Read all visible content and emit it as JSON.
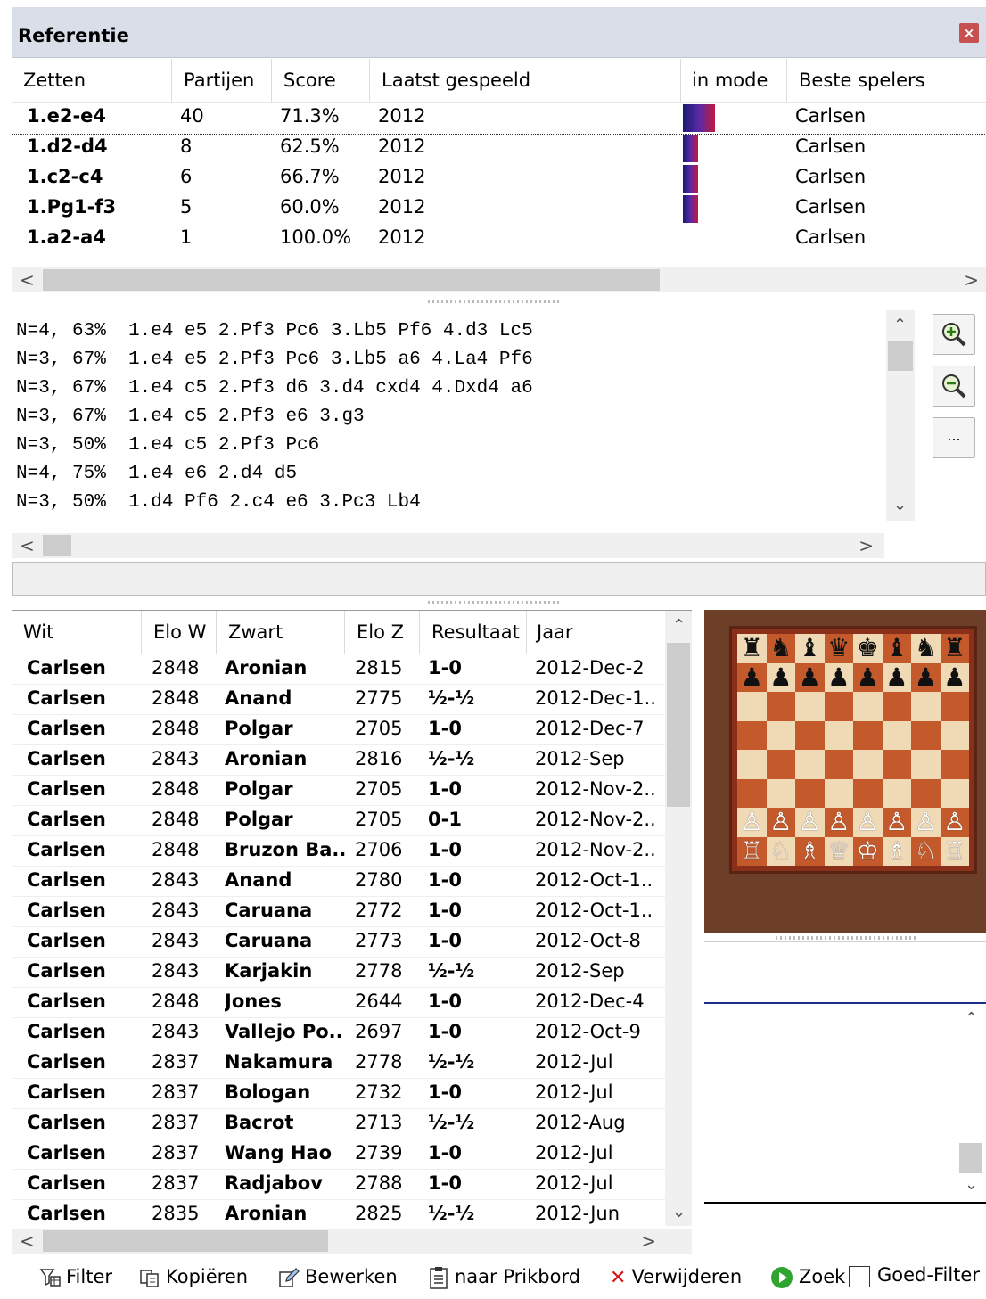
{
  "panel": {
    "title": "Referentie",
    "close": "×"
  },
  "moves_table": {
    "headers": [
      "Zetten",
      "Partijen",
      "Score",
      "Laatst gespeeld",
      "in mode",
      "Beste spelers"
    ],
    "rows": [
      {
        "move": "1.e2-e4",
        "games": "40",
        "score": "71.3%",
        "last": "2012",
        "trend": 1.0,
        "best": "Carlsen"
      },
      {
        "move": "1.d2-d4",
        "games": "8",
        "score": "62.5%",
        "last": "2012",
        "trend": 0.35,
        "best": "Carlsen"
      },
      {
        "move": "1.c2-c4",
        "games": "6",
        "score": "66.7%",
        "last": "2012",
        "trend": 0.35,
        "best": "Carlsen"
      },
      {
        "move": "1.Pg1-f3",
        "games": "5",
        "score": "60.0%",
        "last": "2012",
        "trend": 0.35,
        "best": "Carlsen"
      },
      {
        "move": "1.a2-a4",
        "games": "1",
        "score": "100.0%",
        "last": "2012",
        "trend": 0.0,
        "best": "Carlsen"
      }
    ]
  },
  "lines": [
    "N=4, 63%  1.e4 e5 2.Pf3 Pc6 3.Lb5 Pf6 4.d3 Lc5",
    "N=3, 67%  1.e4 e5 2.Pf3 Pc6 3.Lb5 a6 4.La4 Pf6",
    "N=3, 67%  1.e4 c5 2.Pf3 d6 3.d4 cxd4 4.Dxd4 a6",
    "N=3, 67%  1.e4 c5 2.Pf3 e6 3.g3",
    "N=3, 50%  1.e4 c5 2.Pf3 Pc6",
    "N=4, 75%  1.e4 e6 2.d4 d5",
    "N=3, 50%  1.d4 Pf6 2.c4 e6 3.Pc3 Lb4"
  ],
  "side_buttons": {
    "zoom_in": "zoom-in-icon",
    "zoom_out": "zoom-out-icon",
    "more": "..."
  },
  "games_table": {
    "headers": [
      "Wit",
      "Elo W",
      "Zwart",
      "Elo Z",
      "Resultaat",
      "Jaar"
    ],
    "rows": [
      [
        "Carlsen",
        "2848",
        "Aronian",
        "2815",
        "1-0",
        "2012-Dec-2"
      ],
      [
        "Carlsen",
        "2848",
        "Anand",
        "2775",
        "½-½",
        "2012-Dec-1.."
      ],
      [
        "Carlsen",
        "2848",
        "Polgar",
        "2705",
        "1-0",
        "2012-Dec-7"
      ],
      [
        "Carlsen",
        "2843",
        "Aronian",
        "2816",
        "½-½",
        "2012-Sep"
      ],
      [
        "Carlsen",
        "2848",
        "Polgar",
        "2705",
        "1-0",
        "2012-Nov-2.."
      ],
      [
        "Carlsen",
        "2848",
        "Polgar",
        "2705",
        "0-1",
        "2012-Nov-2.."
      ],
      [
        "Carlsen",
        "2848",
        "Bruzon Ba..",
        "2706",
        "1-0",
        "2012-Nov-2.."
      ],
      [
        "Carlsen",
        "2843",
        "Anand",
        "2780",
        "1-0",
        "2012-Oct-1.."
      ],
      [
        "Carlsen",
        "2843",
        "Caruana",
        "2772",
        "1-0",
        "2012-Oct-1.."
      ],
      [
        "Carlsen",
        "2843",
        "Caruana",
        "2773",
        "1-0",
        "2012-Oct-8"
      ],
      [
        "Carlsen",
        "2843",
        "Karjakin",
        "2778",
        "½-½",
        "2012-Sep"
      ],
      [
        "Carlsen",
        "2848",
        "Jones",
        "2644",
        "1-0",
        "2012-Dec-4"
      ],
      [
        "Carlsen",
        "2843",
        "Vallejo Po..",
        "2697",
        "1-0",
        "2012-Oct-9"
      ],
      [
        "Carlsen",
        "2837",
        "Nakamura",
        "2778",
        "½-½",
        "2012-Jul"
      ],
      [
        "Carlsen",
        "2837",
        "Bologan",
        "2732",
        "1-0",
        "2012-Jul"
      ],
      [
        "Carlsen",
        "2837",
        "Bacrot",
        "2713",
        "½-½",
        "2012-Aug"
      ],
      [
        "Carlsen",
        "2837",
        "Wang Hao",
        "2739",
        "1-0",
        "2012-Jul"
      ],
      [
        "Carlsen",
        "2837",
        "Radjabov",
        "2788",
        "1-0",
        "2012-Jul"
      ],
      [
        "Carlsen",
        "2835",
        "Aronian",
        "2825",
        "½-½",
        "2012-Jun"
      ]
    ]
  },
  "board": {
    "black_back": [
      "♜",
      "♞",
      "♝",
      "♛",
      "♚",
      "♝",
      "♞",
      "♜"
    ],
    "black_pawn": "♟",
    "white_pawn": "♙",
    "white_back": [
      "♖",
      "♘",
      "♗",
      "♕",
      "♔",
      "♗",
      "♘",
      "♖"
    ]
  },
  "toolbar": {
    "filter": "Filter",
    "copy": "Kopiëren",
    "edit": "Bewerken",
    "clipboard": "naar Prikbord",
    "delete": "Verwijderen",
    "search": "Zoek",
    "good_filter": "Goed-Filter"
  },
  "colors": {
    "header_bg": "#d9dee8",
    "light_square": "#f0d9b5",
    "dark_square": "#c45a2c",
    "board_frame": "#6b3a22",
    "wood": "#7a4a30"
  }
}
